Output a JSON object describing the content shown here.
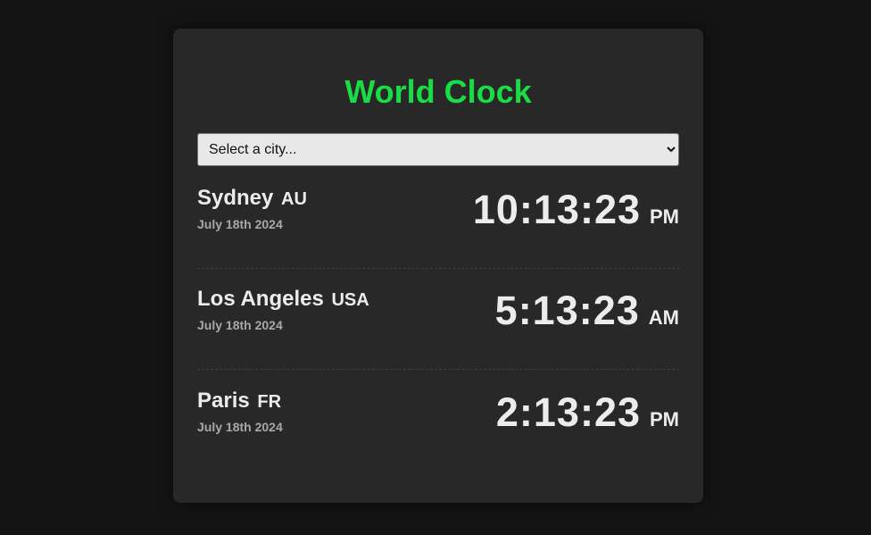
{
  "title": "World Clock",
  "select": {
    "selected": "Select a city..."
  },
  "clocks": [
    {
      "city": "Sydney",
      "country": "AU",
      "date": "July 18th 2024",
      "time": "10:13:23",
      "period": "PM"
    },
    {
      "city": "Los Angeles",
      "country": "USA",
      "date": "July 18th 2024",
      "time": "5:13:23",
      "period": "AM"
    },
    {
      "city": "Paris",
      "country": "FR",
      "date": "July 18th 2024",
      "time": "2:13:23",
      "period": "PM"
    }
  ],
  "colors": {
    "accent": "#19dd44",
    "background": "#141414",
    "card": "#282828"
  }
}
